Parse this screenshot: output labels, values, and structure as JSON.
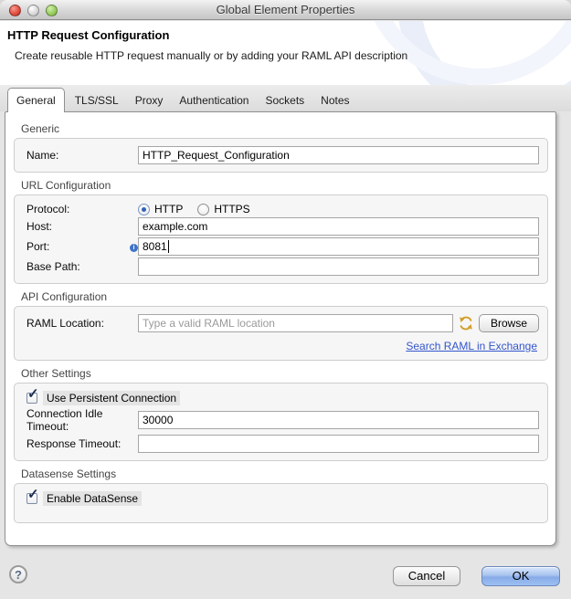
{
  "window": {
    "title": "Global Element Properties"
  },
  "banner": {
    "title": "HTTP Request Configuration",
    "subtitle": "Create reusable HTTP request manually or by adding your RAML API description"
  },
  "tabs": [
    {
      "label": "General",
      "active": true
    },
    {
      "label": "TLS/SSL",
      "active": false
    },
    {
      "label": "Proxy",
      "active": false
    },
    {
      "label": "Authentication",
      "active": false
    },
    {
      "label": "Sockets",
      "active": false
    },
    {
      "label": "Notes",
      "active": false
    }
  ],
  "generic": {
    "title": "Generic",
    "name_label": "Name:",
    "name_value": "HTTP_Request_Configuration"
  },
  "url_config": {
    "title": "URL Configuration",
    "protocol_label": "Protocol:",
    "protocol_options": [
      "HTTP",
      "HTTPS"
    ],
    "protocol_selected": "HTTP",
    "host_label": "Host:",
    "host_value": "example.com",
    "port_label": "Port:",
    "port_value": "8081",
    "base_path_label": "Base Path:",
    "base_path_value": ""
  },
  "api_config": {
    "title": "API Configuration",
    "raml_label": "RAML Location:",
    "raml_placeholder": "Type a valid RAML location",
    "browse_label": "Browse",
    "exchange_link": "Search RAML in Exchange"
  },
  "other_settings": {
    "title": "Other Settings",
    "persistent_connection_label": "Use Persistent Connection",
    "persistent_connection_checked": true,
    "idle_timeout_label": "Connection Idle Timeout:",
    "idle_timeout_value": "30000",
    "response_timeout_label": "Response Timeout:",
    "response_timeout_value": ""
  },
  "datasense": {
    "title": "Datasense Settings",
    "enable_label": "Enable DataSense",
    "enable_checked": true
  },
  "footer": {
    "help_label": "?",
    "cancel_label": "Cancel",
    "ok_label": "OK"
  },
  "colors": {
    "ok_button_blue": "#9cc0f2",
    "link_blue": "#3355cc",
    "sync_icon_gold": "#d19f2a",
    "info_badge_blue": "#3f74c9",
    "check_navy": "#1d2d52"
  }
}
